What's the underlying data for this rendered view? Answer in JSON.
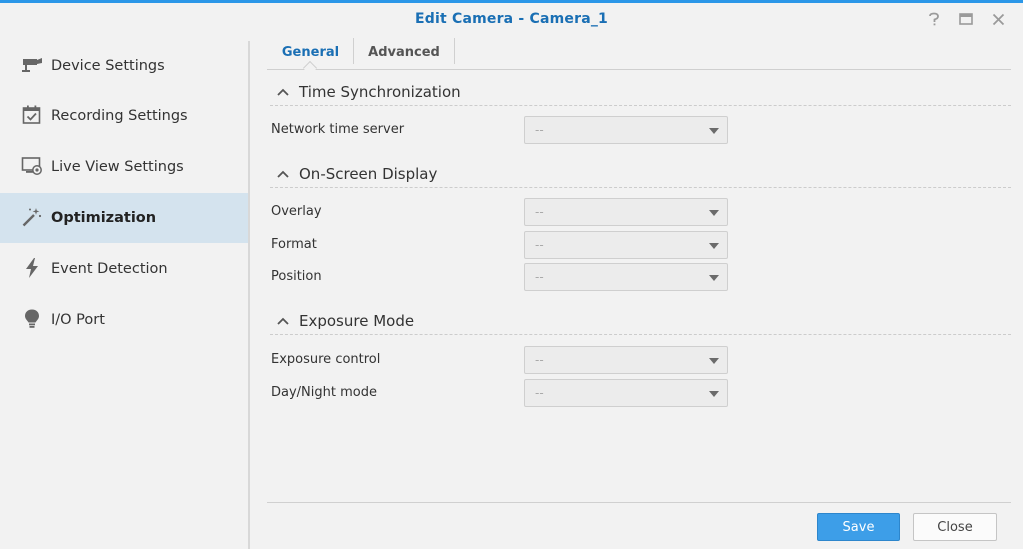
{
  "window": {
    "title": "Edit Camera - Camera_1",
    "accent_color": "#2b97e8",
    "controls": [
      "help-icon",
      "maximize-icon",
      "close-icon"
    ]
  },
  "sidebar": {
    "active_color": "#d4e3ee",
    "items": [
      {
        "label": "Device Settings",
        "icon": "camera-icon"
      },
      {
        "label": "Recording Settings",
        "icon": "calendar-check-icon"
      },
      {
        "label": "Live View Settings",
        "icon": "monitor-icon"
      },
      {
        "label": "Optimization",
        "icon": "magic-wand-icon",
        "active": true
      },
      {
        "label": "Event Detection",
        "icon": "lightning-icon"
      },
      {
        "label": "I/O Port",
        "icon": "lightbulb-icon"
      }
    ]
  },
  "tabs": [
    {
      "label": "General",
      "active": true
    },
    {
      "label": "Advanced",
      "active": false
    }
  ],
  "sections": [
    {
      "title": "Time Synchronization",
      "fields": [
        {
          "label": "Network time server",
          "value": "--"
        }
      ]
    },
    {
      "title": "On-Screen Display",
      "fields": [
        {
          "label": "Overlay",
          "value": "--"
        },
        {
          "label": "Format",
          "value": "--"
        },
        {
          "label": "Position",
          "value": "--"
        }
      ]
    },
    {
      "title": "Exposure Mode",
      "fields": [
        {
          "label": "Exposure control",
          "value": "--"
        },
        {
          "label": "Day/Night mode",
          "value": "--"
        }
      ]
    }
  ],
  "footer": {
    "save_label": "Save",
    "close_label": "Close"
  }
}
